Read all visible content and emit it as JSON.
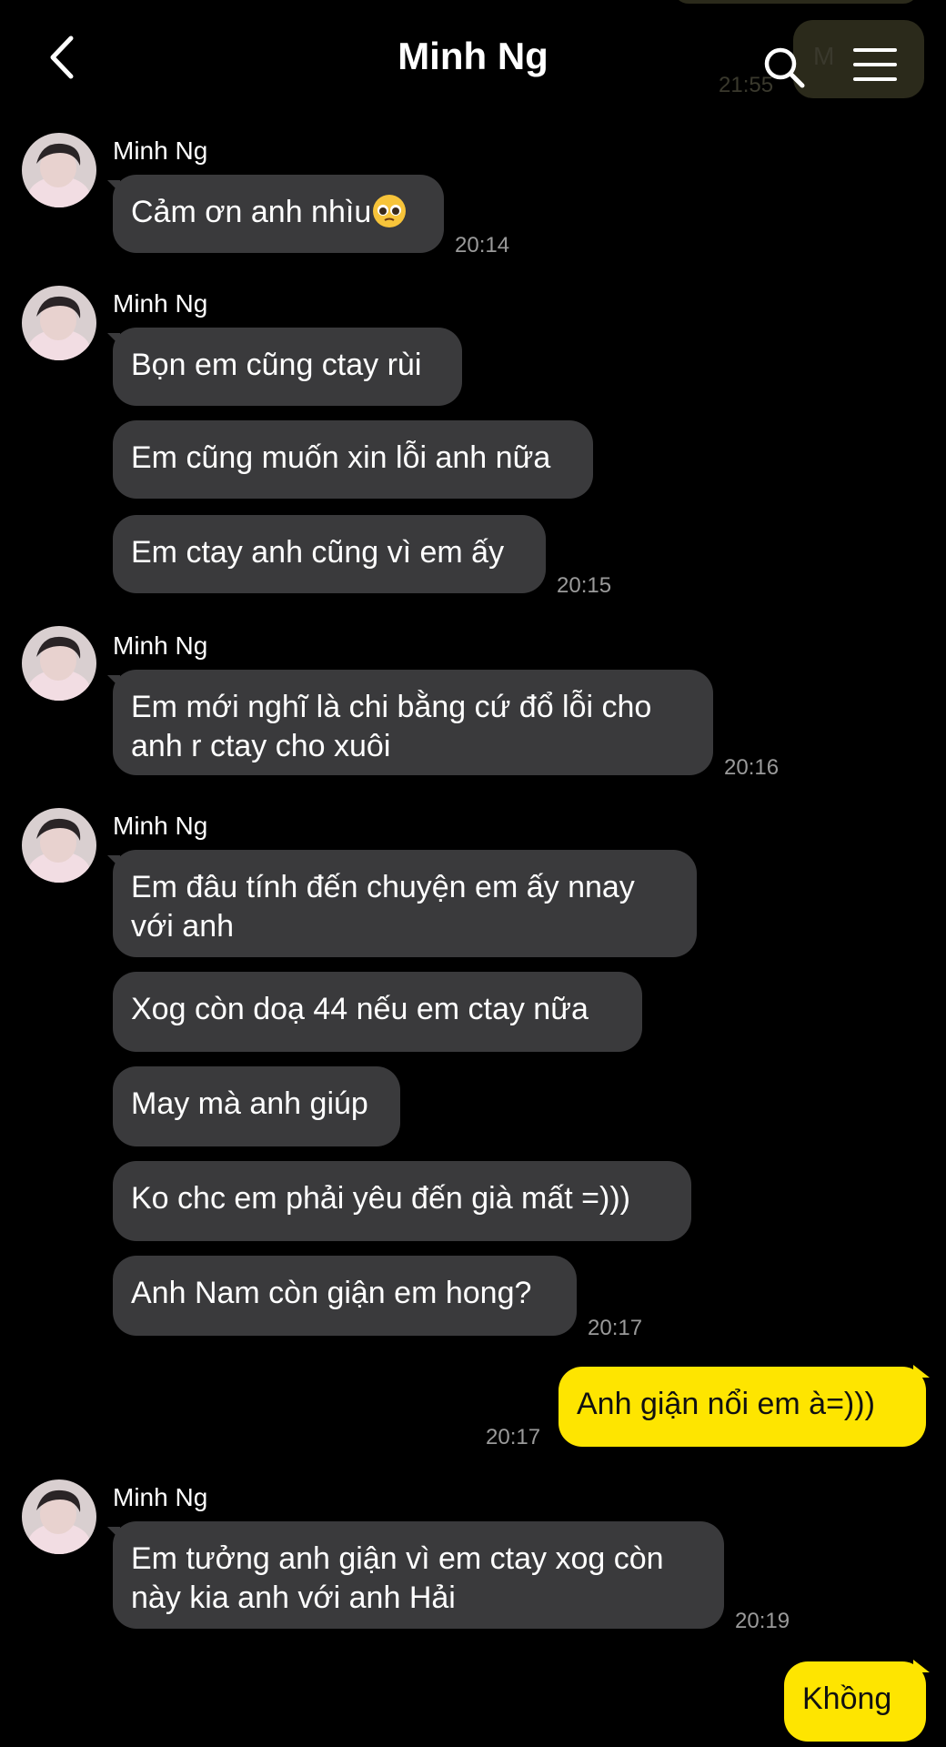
{
  "header": {
    "title": "Minh Ng",
    "peek_text": "M",
    "peek_time": "21:55"
  },
  "colors": {
    "background": "#000000",
    "incoming_bubble": "#3a3a3c",
    "outgoing_bubble": "#fee500",
    "timestamp": "#9a9a9a"
  },
  "icons": [
    "back-chevron-icon",
    "search-icon",
    "menu-icon",
    "emoji-pleading-face-icon"
  ],
  "messages": [
    {
      "sender": "Minh Ng",
      "text": "Cảm ơn anh nhìu",
      "time": "20:14"
    },
    {
      "sender": "Minh Ng",
      "text": "Bọn em cũng ctay rùi"
    },
    {
      "text": "Em cũng muốn xin lỗi anh nữa"
    },
    {
      "text": "Em ctay anh cũng vì em ấy",
      "time": "20:15"
    },
    {
      "sender": "Minh Ng",
      "text": "Em mới nghĩ là chi bằng cứ đổ lỗi cho anh r ctay cho xuôi",
      "time": "20:16"
    },
    {
      "sender": "Minh Ng",
      "text": "Em đâu tính đến chuyện em ấy nnay với anh"
    },
    {
      "text": "Xog còn doạ 44 nếu em ctay nữa"
    },
    {
      "text": "May mà anh giúp"
    },
    {
      "text": "Ko chc em phải yêu đến già mất =)))"
    },
    {
      "text": "Anh Nam còn giận em hong?",
      "time": "20:17"
    },
    {
      "text": "Anh giận nổi em à=)))",
      "time": "20:17"
    },
    {
      "sender": "Minh Ng",
      "text": "Em tưởng anh giận vì em ctay xog còn này kia anh với anh Hải",
      "time": "20:19"
    },
    {
      "text": "Khồng"
    }
  ]
}
